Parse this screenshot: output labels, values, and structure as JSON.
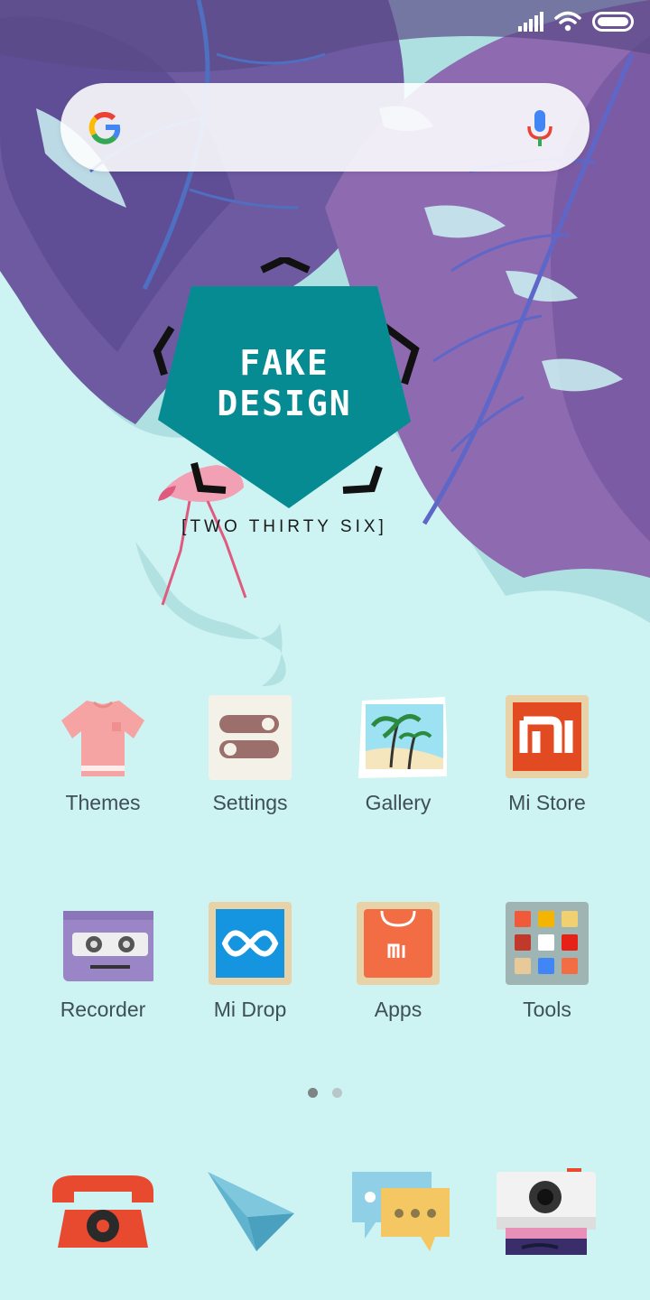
{
  "status_bar": {
    "signal": "signal-icon",
    "wifi": "wifi-icon",
    "battery": "battery-icon"
  },
  "search": {
    "logo": "google-logo-icon",
    "mic": "mic-icon"
  },
  "widget": {
    "title_line1": "FAKE",
    "title_line2": "DESIGN",
    "subtitle": "[TWO THIRTY SIX]"
  },
  "apps": [
    {
      "label": "Themes",
      "icon": "tshirt-icon"
    },
    {
      "label": "Settings",
      "icon": "toggles-icon"
    },
    {
      "label": "Gallery",
      "icon": "palm-photo-icon"
    },
    {
      "label": "Mi Store",
      "icon": "mi-logo-icon"
    },
    {
      "label": "Recorder",
      "icon": "cassette-icon"
    },
    {
      "label": "Mi Drop",
      "icon": "infinity-icon"
    },
    {
      "label": "Apps",
      "icon": "shopping-bag-icon"
    },
    {
      "label": "Tools",
      "icon": "folder-grid-icon"
    }
  ],
  "page_indicator": {
    "count": 2,
    "active": 0
  },
  "dock": [
    {
      "name": "phone",
      "icon": "telephone-icon"
    },
    {
      "name": "messages-send",
      "icon": "paper-plane-icon"
    },
    {
      "name": "messaging",
      "icon": "chat-bubbles-icon"
    },
    {
      "name": "camera",
      "icon": "camera-printer-icon"
    }
  ],
  "colors": {
    "background": "#cdf3f3",
    "leaf_purple": "#8e6ab0",
    "widget_teal": "#068b92",
    "label_text": "#3f4f57"
  }
}
